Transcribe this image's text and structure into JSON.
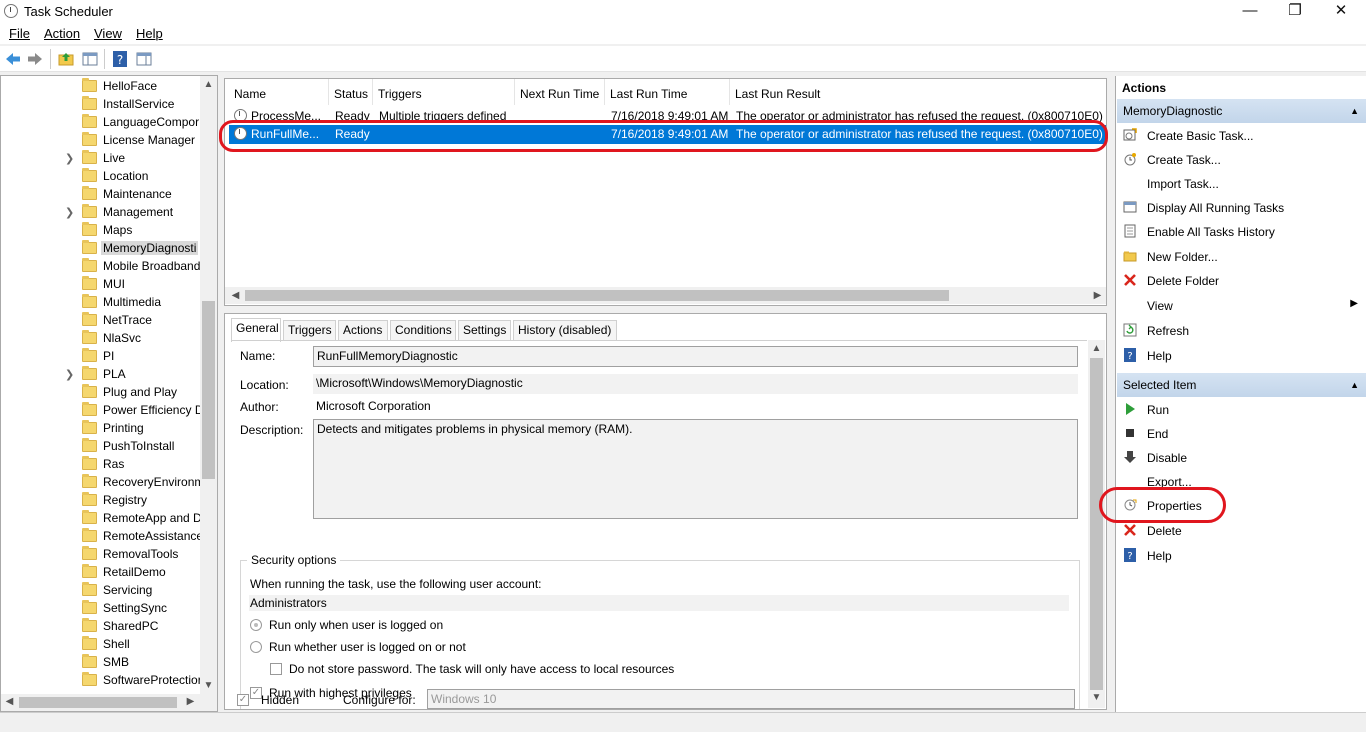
{
  "window": {
    "title": "Task Scheduler",
    "controls": {
      "minimize": "—",
      "restore": "❐",
      "close": "✕"
    }
  },
  "menu": {
    "file": "File",
    "action": "Action",
    "view": "View",
    "help": "Help"
  },
  "tree": {
    "items": [
      {
        "label": "HelloFace",
        "expandable": false
      },
      {
        "label": "InstallService",
        "expandable": false
      },
      {
        "label": "LanguageCompor",
        "expandable": false
      },
      {
        "label": "License Manager",
        "expandable": false
      },
      {
        "label": "Live",
        "expandable": true
      },
      {
        "label": "Location",
        "expandable": false
      },
      {
        "label": "Maintenance",
        "expandable": false
      },
      {
        "label": "Management",
        "expandable": true
      },
      {
        "label": "Maps",
        "expandable": false
      },
      {
        "label": "MemoryDiagnosti",
        "expandable": false,
        "selected": true
      },
      {
        "label": "Mobile Broadband",
        "expandable": false
      },
      {
        "label": "MUI",
        "expandable": false
      },
      {
        "label": "Multimedia",
        "expandable": false
      },
      {
        "label": "NetTrace",
        "expandable": false
      },
      {
        "label": "NlaSvc",
        "expandable": false
      },
      {
        "label": "PI",
        "expandable": false
      },
      {
        "label": "PLA",
        "expandable": true
      },
      {
        "label": "Plug and Play",
        "expandable": false
      },
      {
        "label": "Power Efficiency D",
        "expandable": false
      },
      {
        "label": "Printing",
        "expandable": false
      },
      {
        "label": "PushToInstall",
        "expandable": false
      },
      {
        "label": "Ras",
        "expandable": false
      },
      {
        "label": "RecoveryEnvironm",
        "expandable": false
      },
      {
        "label": "Registry",
        "expandable": false
      },
      {
        "label": "RemoteApp and D",
        "expandable": false
      },
      {
        "label": "RemoteAssistance",
        "expandable": false
      },
      {
        "label": "RemovalTools",
        "expandable": false
      },
      {
        "label": "RetailDemo",
        "expandable": false
      },
      {
        "label": "Servicing",
        "expandable": false
      },
      {
        "label": "SettingSync",
        "expandable": false
      },
      {
        "label": "SharedPC",
        "expandable": false
      },
      {
        "label": "Shell",
        "expandable": false
      },
      {
        "label": "SMB",
        "expandable": false
      },
      {
        "label": "SoftwareProtectior",
        "expandable": false
      }
    ]
  },
  "tasklist": {
    "columns": [
      "Name",
      "Status",
      "Triggers",
      "Next Run Time",
      "Last Run Time",
      "Last Run Result"
    ],
    "rows": [
      {
        "name": "ProcessMe...",
        "status": "Ready",
        "triggers": "Multiple triggers defined",
        "next": "",
        "last": "7/16/2018 9:49:01 AM",
        "result": "The operator or administrator has refused the request. (0x800710E0)"
      },
      {
        "name": "RunFullMe...",
        "status": "Ready",
        "triggers": "",
        "next": "",
        "last": "7/16/2018 9:49:01 AM",
        "result": "The operator or administrator has refused the request. (0x800710E0)",
        "selected": true
      }
    ]
  },
  "details": {
    "tabs": [
      "General",
      "Triggers",
      "Actions",
      "Conditions",
      "Settings",
      "History (disabled)"
    ],
    "name_label": "Name:",
    "name_value": "RunFullMemoryDiagnostic",
    "location_label": "Location:",
    "location_value": "\\Microsoft\\Windows\\MemoryDiagnostic",
    "author_label": "Author:",
    "author_value": "Microsoft Corporation",
    "description_label": "Description:",
    "description_value": "Detects and mitigates problems in physical memory (RAM).",
    "security": {
      "title": "Security options",
      "account_prompt": "When running the task, use the following user account:",
      "account": "Administrators",
      "opt_logged_on": "Run only when user is logged on",
      "opt_whether": "Run whether user is logged on or not",
      "opt_no_password": "Do not store password.  The task will only have access to local resources",
      "opt_highest": "Run with highest privileges"
    },
    "hidden_label": "Hidden",
    "configure_label": "Configure for:",
    "configure_value": "Windows 10"
  },
  "actions": {
    "title": "Actions",
    "section1": "MemoryDiagnostic",
    "items1": [
      {
        "label": "Create Basic Task...",
        "icon": "create-basic-task-icon"
      },
      {
        "label": "Create Task...",
        "icon": "create-task-icon"
      },
      {
        "label": "Import Task...",
        "icon": ""
      },
      {
        "label": "Display All Running Tasks",
        "icon": "running-tasks-icon"
      },
      {
        "label": "Enable All Tasks History",
        "icon": "tasks-history-icon"
      },
      {
        "label": "New Folder...",
        "icon": "new-folder-icon"
      },
      {
        "label": "Delete Folder",
        "icon": "delete-icon"
      },
      {
        "label": "View",
        "icon": ""
      },
      {
        "label": "Refresh",
        "icon": "refresh-icon"
      },
      {
        "label": "Help",
        "icon": "help-icon"
      }
    ],
    "section2": "Selected Item",
    "items2": [
      {
        "label": "Run",
        "icon": "run-icon"
      },
      {
        "label": "End",
        "icon": "end-icon"
      },
      {
        "label": "Disable",
        "icon": "disable-icon"
      },
      {
        "label": "Export...",
        "icon": ""
      },
      {
        "label": "Properties",
        "icon": "properties-icon"
      },
      {
        "label": "Delete",
        "icon": "delete-icon"
      },
      {
        "label": "Help",
        "icon": "help-icon"
      }
    ]
  },
  "colors": {
    "selection": "#0078d7",
    "annotation": "#e0161e",
    "header_gradient": "#c2d5ea"
  }
}
